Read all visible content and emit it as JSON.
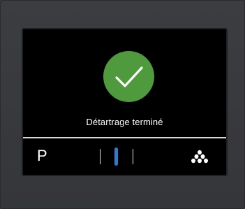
{
  "screen": {
    "status_message": "Détartrage terminé",
    "icon": "checkmark-icon"
  },
  "bottom_bar": {
    "program_label": "P",
    "strength": {
      "levels": 3,
      "selected_level": 2
    },
    "aroma_icon": "coffee-beans-icon"
  },
  "colors": {
    "badge_green": "#4e9a3c",
    "selection_blue": "#2e7bd0",
    "screen_background": "#000000",
    "bezel": "#3a3b3d"
  }
}
